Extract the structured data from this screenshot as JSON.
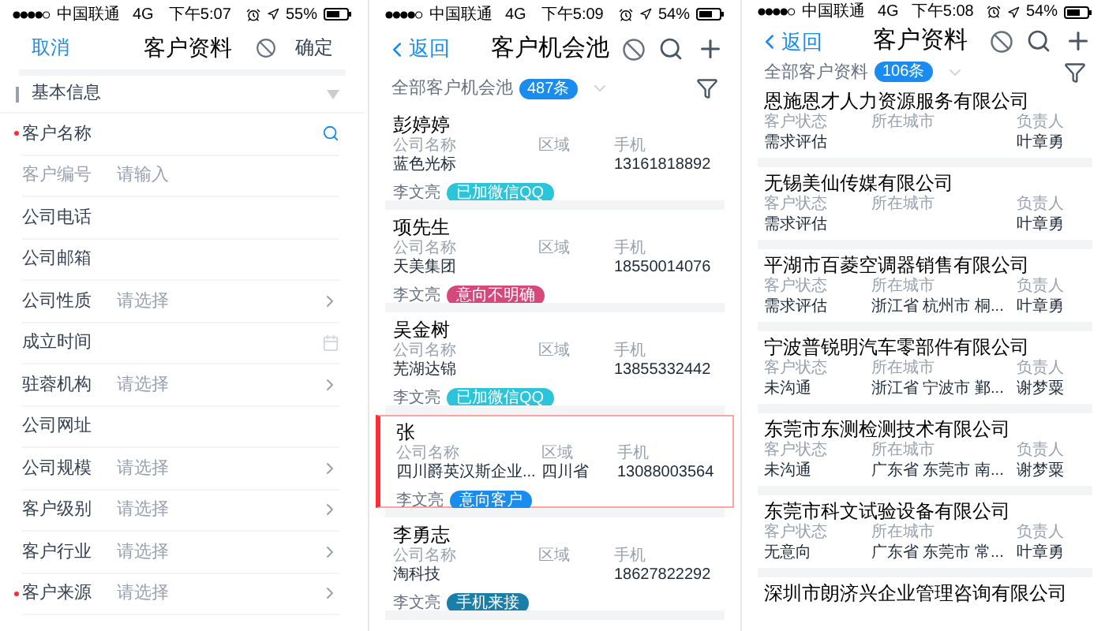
{
  "form_screen": {
    "status_bar": {
      "carrier": "中国联通",
      "network": "4G",
      "time": "下午5:07",
      "battery": "55%"
    },
    "header": {
      "cancel": "取消",
      "title": "客户资料",
      "confirm": "确定"
    },
    "section": {
      "title": "基本信息",
      "expanded": true
    },
    "fields": [
      {
        "label": "客户名称",
        "required": true,
        "disabled": false,
        "kind": "search"
      },
      {
        "label": "客户编号",
        "required": false,
        "disabled": true,
        "kind": "text",
        "placeholder": "请输入"
      },
      {
        "label": "公司电话",
        "required": false,
        "disabled": false,
        "kind": "text"
      },
      {
        "label": "公司邮箱",
        "required": false,
        "disabled": false,
        "kind": "text"
      },
      {
        "label": "公司性质",
        "required": false,
        "disabled": false,
        "kind": "select",
        "placeholder": "请选择"
      },
      {
        "label": "成立时间",
        "required": false,
        "disabled": false,
        "kind": "date"
      },
      {
        "label": "驻蓉机构",
        "required": false,
        "disabled": false,
        "kind": "select",
        "placeholder": "请选择"
      },
      {
        "label": "公司网址",
        "required": false,
        "disabled": false,
        "kind": "text"
      },
      {
        "label": "公司规模",
        "required": false,
        "disabled": false,
        "kind": "select",
        "placeholder": "请选择"
      },
      {
        "label": "客户级别",
        "required": false,
        "disabled": false,
        "kind": "select",
        "placeholder": "请选择"
      },
      {
        "label": "客户行业",
        "required": false,
        "disabled": false,
        "kind": "select",
        "placeholder": "请选择"
      },
      {
        "label": "客户来源",
        "required": true,
        "disabled": false,
        "kind": "select",
        "placeholder": "请选择"
      }
    ]
  },
  "pool_screen": {
    "status_bar": {
      "carrier": "中国联通",
      "network": "4G",
      "time": "下午5:09",
      "battery": "54%"
    },
    "header": {
      "back": "返回",
      "title": "客户机会池"
    },
    "filter": {
      "label": "全部客户机会池",
      "count": "487条"
    },
    "cards": [
      {
        "name": "彭婷婷",
        "labels": [
          "公司名称",
          "区域",
          "手机"
        ],
        "company": "蓝色光标",
        "phone": "13161818892",
        "owner": "李文亮",
        "tag": {
          "text": "已加微信QQ",
          "color": "#2bc4d8"
        },
        "selected": false
      },
      {
        "name": "项先生",
        "labels": [
          "公司名称",
          "区域",
          "手机"
        ],
        "company": "天美集团",
        "phone": "18550014076",
        "owner": "李文亮",
        "tag": {
          "text": "意向不明确",
          "color": "#d6487a"
        },
        "selected": false
      },
      {
        "name": "吴金树",
        "labels": [
          "公司名称",
          "区域",
          "手机"
        ],
        "company": "芜湖达锦",
        "phone": "13855332442",
        "owner": "李文亮",
        "tag": {
          "text": "已加微信QQ",
          "color": "#2bc4d8"
        },
        "selected": false
      },
      {
        "name": "张",
        "labels": [
          "公司名称",
          "区域",
          "手机"
        ],
        "company": "四川爵英汉斯企业...",
        "region": "四川省",
        "phone": "13088003564",
        "owner": "李文亮",
        "tag": {
          "text": "意向客户",
          "color": "#1a8cf0"
        },
        "selected": true
      },
      {
        "name": "李勇志",
        "labels": [
          "公司名称",
          "区域",
          "手机"
        ],
        "company": "淘科技",
        "phone": "18627822292",
        "owner": "李文亮",
        "tag": {
          "text": "手机来接",
          "color": "#1a7fa8"
        },
        "selected": false
      }
    ]
  },
  "customers_screen": {
    "status_bar": {
      "carrier": "中国联通",
      "network": "4G",
      "time": "下午5:08",
      "battery": "54%"
    },
    "header": {
      "back": "返回",
      "title": "客户资料"
    },
    "filter": {
      "label": "全部客户资料",
      "count": "106条"
    },
    "cards": [
      {
        "name": "恩施恩才人力资源服务有限公司",
        "labels": [
          "客户状态",
          "所在城市",
          "负责人"
        ],
        "status": "需求评估",
        "owner": "叶章勇"
      },
      {
        "name": "无锡美仙传媒有限公司",
        "labels": [
          "客户状态",
          "所在城市",
          "负责人"
        ],
        "status": "需求评估",
        "owner": "叶章勇"
      },
      {
        "name": "平湖市百菱空调器销售有限公司",
        "labels": [
          "客户状态",
          "所在城市",
          "负责人"
        ],
        "status": "需求评估",
        "city": "浙江省 杭州市 桐...",
        "owner": "叶章勇"
      },
      {
        "name": "宁波普锐明汽车零部件有限公司",
        "labels": [
          "客户状态",
          "所在城市",
          "负责人"
        ],
        "status": "未沟通",
        "city": "浙江省 宁波市 鄞...",
        "owner": "谢梦粟"
      },
      {
        "name": "东莞市东测检测技术有限公司",
        "labels": [
          "客户状态",
          "所在城市",
          "负责人"
        ],
        "status": "未沟通",
        "city": "广东省 东莞市 南...",
        "owner": "谢梦粟"
      },
      {
        "name": "东莞市科文试验设备有限公司",
        "labels": [
          "客户状态",
          "所在城市",
          "负责人"
        ],
        "status": "无意向",
        "city": "广东省 东莞市 常...",
        "owner": "叶章勇"
      },
      {
        "name": "深圳市朗济兴企业管理咨询有限公司"
      }
    ]
  }
}
